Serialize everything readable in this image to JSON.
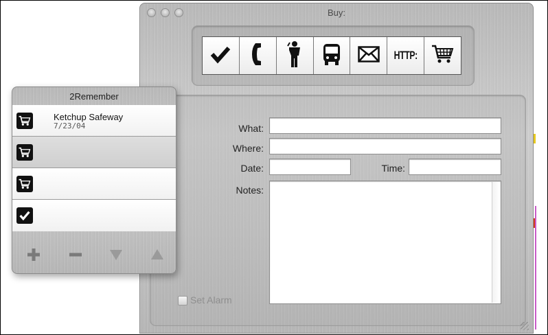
{
  "main_window": {
    "title": "Buy:",
    "toolbar": [
      {
        "name": "checkmark-icon"
      },
      {
        "name": "phone-icon"
      },
      {
        "name": "person-icon"
      },
      {
        "name": "bus-icon"
      },
      {
        "name": "envelope-icon"
      },
      {
        "name": "http-icon",
        "label": "HTTP:"
      },
      {
        "name": "shopping-cart-icon"
      }
    ],
    "form": {
      "what_label": "What:",
      "what_value": "",
      "where_label": "Where:",
      "where_value": "",
      "date_label": "Date:",
      "date_value": "",
      "time_label": "Time:",
      "time_value": "",
      "notes_label": "Notes:",
      "notes_value": "",
      "alarm_label": "Set Alarm",
      "alarm_checked": false
    }
  },
  "panel": {
    "title": "2Remember",
    "items": [
      {
        "icon": "shopping-cart-icon",
        "title": "Ketchup Safeway",
        "date": "7/23/04"
      },
      {
        "icon": "shopping-cart-icon",
        "title": "",
        "date": ""
      },
      {
        "icon": "shopping-cart-icon",
        "title": "",
        "date": ""
      },
      {
        "icon": "checkmark-icon",
        "title": "",
        "date": ""
      }
    ],
    "buttons": [
      "add-button",
      "remove-button",
      "move-down-button",
      "move-up-button"
    ]
  }
}
